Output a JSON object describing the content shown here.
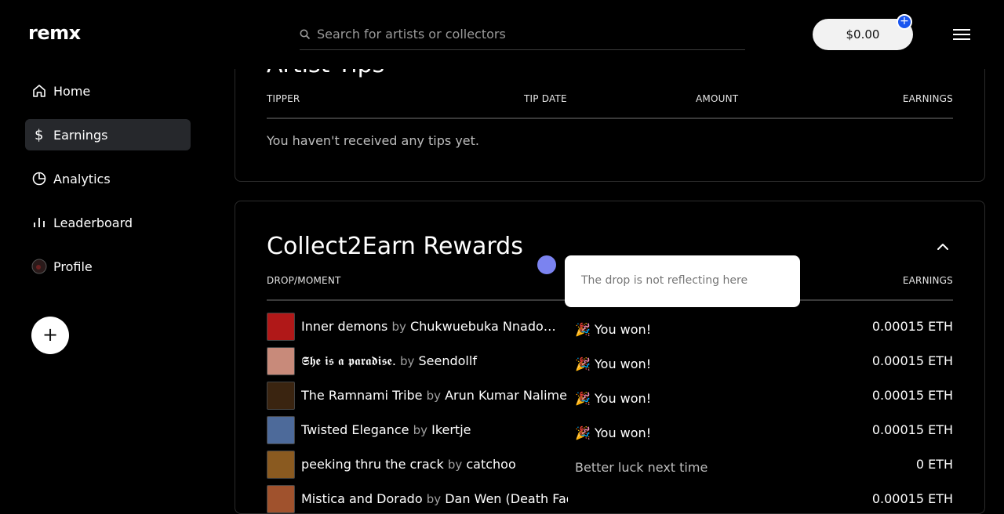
{
  "header": {
    "logo": "remx",
    "search_placeholder": "Search for artists or collectors",
    "balance": "$0.00",
    "add_funds": "+"
  },
  "sidebar": {
    "items": [
      {
        "label": "Home",
        "icon": "home-icon"
      },
      {
        "label": "Earnings",
        "icon": "dollar-icon",
        "active": true
      },
      {
        "label": "Analytics",
        "icon": "pie-chart-icon"
      },
      {
        "label": "Leaderboard",
        "icon": "bar-chart-icon"
      },
      {
        "label": "Profile",
        "icon": "avatar-icon"
      }
    ],
    "create_label": "+"
  },
  "tips": {
    "title": "Artist Tips",
    "columns": [
      "TIPPER",
      "TIP DATE",
      "AMOUNT",
      "EARNINGS"
    ],
    "empty": "You haven't received any tips yet."
  },
  "collect2earn": {
    "title": "Collect2Earn Rewards",
    "columns": {
      "drop": "DROP/MOMENT",
      "earnings": "EARNINGS"
    },
    "rows": [
      {
        "title": "Inner demons",
        "by": "by",
        "artist": "Chukwuebuka Nnado…",
        "result": "🎉 You won!",
        "earnings": "0.00015 ETH",
        "thumb": "#b01818"
      },
      {
        "title": "𝕾𝖍𝖊 𝖎𝖘 𝖆 𝖕𝖆𝖗𝖆𝖉𝖎𝖘𝖊.",
        "by": "by",
        "artist": "Seendollf",
        "result": "🎉 You won!",
        "earnings": "0.00015 ETH",
        "thumb": "#c88a7a"
      },
      {
        "title": "The Ramnami Tribe",
        "by": "by",
        "artist": "Arun Kumar Nalimel",
        "result": "🎉 You won!",
        "earnings": "0.00015 ETH",
        "thumb": "#3a2410"
      },
      {
        "title": "Twisted Elegance",
        "by": "by",
        "artist": "Ikertje",
        "result": "🎉 You won!",
        "earnings": "0.00015 ETH",
        "thumb": "#4d6a9a"
      },
      {
        "title": "peeking thru the crack",
        "by": "by",
        "artist": "catchoo",
        "result": "Better luck next time",
        "earnings": "0 ETH",
        "thumb": "#8a5a20",
        "lose": true
      },
      {
        "title": "Mistica and Dorado",
        "by": "by",
        "artist": "Dan Wen (Death Fad…",
        "result": "",
        "earnings": "0.00015 ETH",
        "thumb": "#a0522d"
      }
    ]
  },
  "tooltip": {
    "text": "The drop is not reflecting here"
  }
}
